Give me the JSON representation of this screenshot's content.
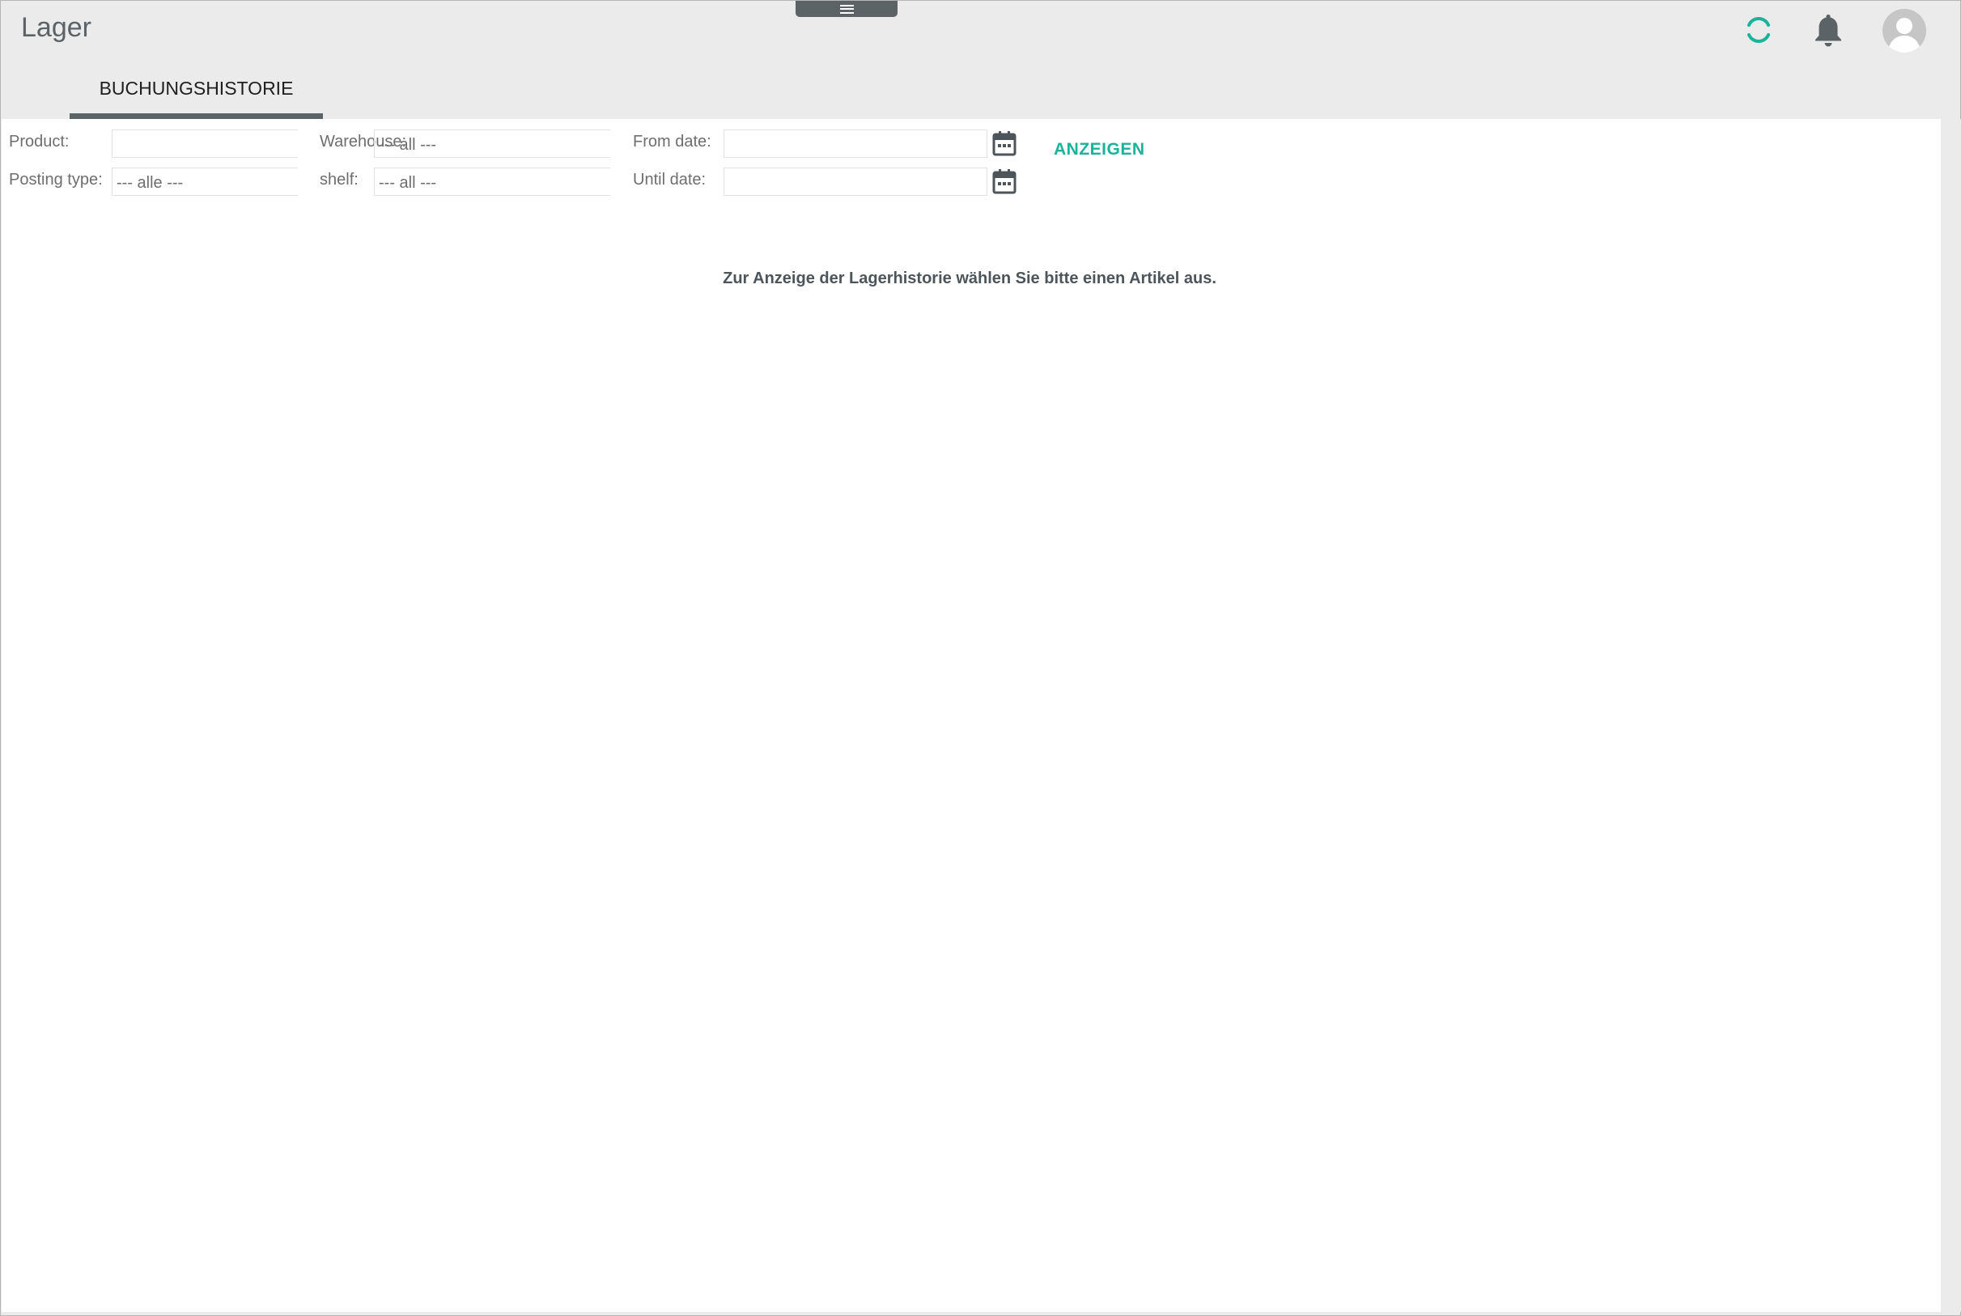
{
  "header": {
    "app_title": "Lager",
    "icons": {
      "menu": "hamburger-icon",
      "sync": "sync-icon",
      "notifications": "bell-icon",
      "profile": "user-avatar-icon"
    },
    "colors": {
      "accent": "#18b49a",
      "dark": "#5b6367",
      "background": "#ebebeb"
    }
  },
  "tabs": [
    {
      "label": "BUCHUNGSHISTORIE",
      "active": true
    }
  ],
  "filters": {
    "product": {
      "label": "Product:",
      "value": ""
    },
    "posting_type": {
      "label": "Posting type:",
      "value": "--- alle ---"
    },
    "warehouse": {
      "label": "Warehouse:",
      "value": "--- all ---"
    },
    "shelf": {
      "label": "shelf:",
      "value": "--- all ---"
    },
    "from_date": {
      "label": "From date:",
      "value": ""
    },
    "until_date": {
      "label": "Until date:",
      "value": ""
    },
    "show_button": "ANZEIGEN"
  },
  "main": {
    "message": "Zur Anzeige der Lagerhistorie wählen Sie bitte einen Artikel aus."
  }
}
